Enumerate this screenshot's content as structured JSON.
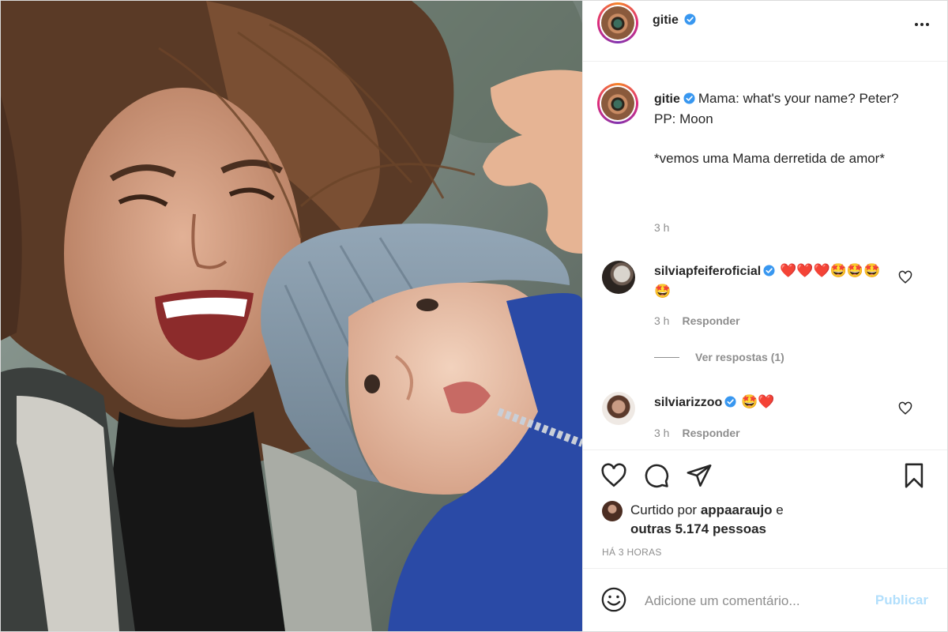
{
  "post": {
    "author": "gitie",
    "verified": true
  },
  "caption": {
    "username": "gitie",
    "text": "Mama: what's your name? Peter?\nPP: Moon\n\n*vemos uma Mama derretida de amor*",
    "time": "3 h"
  },
  "comments": [
    {
      "username": "silviapfeiferoficial",
      "text": "❤️❤️❤️🤩🤩🤩🤩",
      "time": "3 h",
      "reply_label": "Responder",
      "view_replies": "Ver respostas (1)"
    },
    {
      "username": "silviarizzoo",
      "text": "🤩❤️",
      "time": "3 h",
      "reply_label": "Responder"
    }
  ],
  "likes": {
    "prefix": "Curtido por",
    "user": "appaaraujo",
    "connector": "e",
    "others": "outras 5.174 pessoas"
  },
  "timestamp": "HÁ 3 HORAS",
  "comment_input": {
    "placeholder": "Adicione um comentário...",
    "submit_label": "Publicar"
  },
  "colors": {
    "verified": "#3897f0",
    "heart": "#ed4956",
    "publish_disabled": "#b2dffc",
    "muted_text": "#8e8e8e"
  }
}
